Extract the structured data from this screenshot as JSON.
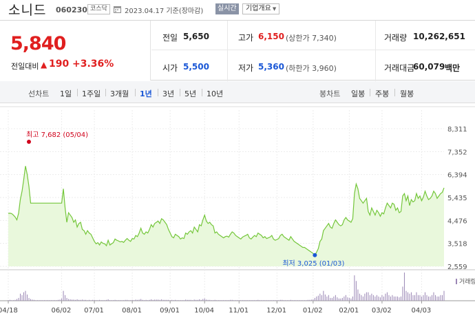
{
  "header": {
    "stock_name": "소니드",
    "stock_code": "060230",
    "market": "코스닥",
    "date_text": "2023.04.17  기준(장마감)",
    "realtime_label": "실시간",
    "overview_label": "기업개요",
    "calendar_icon": "calendar-icon"
  },
  "summary": {
    "current_price": "5,840",
    "diff_label": "전일대비",
    "diff_arrow": "▲",
    "diff_value": "190",
    "diff_rate": "+3.36%",
    "prev_close_label": "전일",
    "prev_close": "5,650",
    "high_label": "고가",
    "high": "6,150",
    "upper_limit": "(상한가 7,340)",
    "volume_label": "거래량",
    "volume": "10,262,651",
    "open_label": "시가",
    "open": "5,500",
    "low_label": "저가",
    "low": "5,360",
    "lower_limit": "(하한가 3,960)",
    "amount_label": "거래대금",
    "amount": "60,079",
    "amount_unit": "백만",
    "colors": {
      "up": "#e01f1f",
      "down": "#1a57d6"
    }
  },
  "period_bar": {
    "line_chart_label": "선차트",
    "line_periods": [
      "1일",
      "1주일",
      "3개월",
      "1년",
      "3년",
      "5년",
      "10년"
    ],
    "active_period": "1년",
    "candle_chart_label": "봉차트",
    "candle_periods": [
      "일봉",
      "주봉",
      "월봉"
    ]
  },
  "chart_data": {
    "type": "area",
    "series_color": "#73c639",
    "fill_color": "#e9f8dc",
    "y_ticks": [
      "8,311",
      "7,352",
      "6,394",
      "5,435",
      "4,476",
      "3,518",
      "2,559"
    ],
    "ylim": [
      2559,
      8311
    ],
    "x_ticks": [
      "04/18",
      "06/02",
      "07/01",
      "08/01",
      "09/01",
      "10/04",
      "11/01",
      "12/01",
      "01/02",
      "02/01",
      "03/02",
      "04/03"
    ],
    "x_tick_index": [
      0,
      31,
      50,
      72,
      94,
      114,
      134,
      156,
      177,
      198,
      217,
      240
    ],
    "high_annotation": "최고 7,682 (05/04)",
    "low_annotation": "최저 3,025 (01/03)",
    "high_index": 11,
    "low_index": 178,
    "high_value": 7682,
    "low_value": 3025,
    "volume_label": "거래량",
    "values": [
      4770,
      4780,
      4760,
      4700,
      4620,
      4500,
      4780,
      5350,
      5700,
      6200,
      6750,
      6400,
      5900,
      5200,
      5200,
      5200,
      5200,
      5200,
      5200,
      5200,
      5200,
      5200,
      5200,
      5200,
      5200,
      5200,
      5200,
      5200,
      5200,
      5200,
      5200,
      5200,
      5800,
      5000,
      4400,
      4800,
      4700,
      4600,
      4400,
      4500,
      4200,
      4350,
      4400,
      4100,
      4050,
      3900,
      4050,
      3950,
      3900,
      3750,
      3600,
      3500,
      3550,
      3450,
      3580,
      3520,
      3500,
      3420,
      3650,
      3450,
      3500,
      3550,
      3700,
      3650,
      3620,
      3580,
      3600,
      3560,
      3650,
      3720,
      3650,
      3600,
      3720,
      3700,
      3850,
      3800,
      3950,
      4150,
      3950,
      3900,
      4000,
      3950,
      4100,
      4300,
      4200,
      4350,
      4400,
      4450,
      4350,
      4550,
      4500,
      4400,
      4300,
      4100,
      3950,
      3800,
      3750,
      3900,
      3850,
      3800,
      3700,
      3750,
      3720,
      3950,
      3900,
      4000,
      4050,
      3950,
      4200,
      4100,
      4000,
      4300,
      4250,
      4500,
      4700,
      4450,
      4350,
      4400,
      4300,
      4250,
      3950,
      4000,
      3900,
      3850,
      3800,
      3750,
      3800,
      3820,
      3780,
      3900,
      4000,
      3950,
      3850,
      3800,
      3750,
      3700,
      3780,
      3820,
      3850,
      3900,
      3750,
      3700,
      3780,
      3850,
      3800,
      3950,
      3900,
      3850,
      3750,
      3800,
      3720,
      3750,
      3780,
      3850,
      3700,
      3650,
      3680,
      3720,
      3850,
      3900,
      3800,
      3750,
      3700,
      3650,
      3800,
      3700,
      3600,
      3550,
      3500,
      3450,
      3400,
      3350,
      3350,
      3300,
      3250,
      3200,
      3150,
      3100,
      3025,
      3150,
      3300,
      3600,
      3700,
      4050,
      4150,
      4250,
      4350,
      4200,
      4150,
      4350,
      4500,
      4400,
      4300,
      4250,
      4300,
      4500,
      4600,
      4500,
      4450,
      4400,
      4550,
      5600,
      6000,
      5800,
      5400,
      5300,
      5200,
      5300,
      5400,
      4850,
      4700,
      5000,
      4850,
      4700,
      4900,
      4800,
      4650,
      4800,
      4750,
      5000,
      5200,
      5100,
      5000,
      5200,
      5150,
      4900,
      5000,
      4800,
      4850,
      5500,
      5600,
      5300,
      5500,
      5100,
      5350,
      5250,
      5300,
      5600,
      5400,
      5500,
      5300,
      5450,
      5700,
      5500,
      5350,
      5400,
      5500,
      5700,
      5600,
      5400,
      5500,
      5600,
      5650,
      5840
    ],
    "volumes": [
      0.02,
      0.03,
      0.02,
      0.02,
      0.03,
      0.06,
      0.1,
      0.25,
      0.2,
      0.3,
      0.35,
      0.22,
      0.1,
      0.06,
      0.04,
      0.03,
      0.02,
      0.02,
      0.02,
      0.02,
      0.02,
      0.02,
      0.02,
      0.02,
      0.02,
      0.02,
      0.02,
      0.02,
      0.02,
      0.03,
      0.04,
      0.08,
      0.35,
      0.2,
      0.1,
      0.06,
      0.05,
      0.04,
      0.04,
      0.03,
      0.05,
      0.03,
      0.03,
      0.04,
      0.03,
      0.03,
      0.02,
      0.03,
      0.02,
      0.03,
      0.03,
      0.02,
      0.02,
      0.03,
      0.02,
      0.02,
      0.02,
      0.03,
      0.05,
      0.02,
      0.02,
      0.02,
      0.03,
      0.02,
      0.02,
      0.02,
      0.02,
      0.02,
      0.03,
      0.03,
      0.02,
      0.02,
      0.03,
      0.02,
      0.04,
      0.03,
      0.04,
      0.06,
      0.03,
      0.02,
      0.03,
      0.02,
      0.03,
      0.05,
      0.03,
      0.04,
      0.04,
      0.04,
      0.03,
      0.05,
      0.03,
      0.03,
      0.03,
      0.03,
      0.02,
      0.03,
      0.02,
      0.03,
      0.02,
      0.02,
      0.02,
      0.02,
      0.02,
      0.04,
      0.03,
      0.03,
      0.03,
      0.02,
      0.04,
      0.03,
      0.03,
      0.05,
      0.03,
      0.06,
      0.08,
      0.04,
      0.03,
      0.03,
      0.02,
      0.02,
      0.03,
      0.02,
      0.02,
      0.02,
      0.02,
      0.02,
      0.02,
      0.02,
      0.02,
      0.03,
      0.03,
      0.02,
      0.02,
      0.02,
      0.02,
      0.02,
      0.02,
      0.02,
      0.02,
      0.02,
      0.02,
      0.02,
      0.02,
      0.02,
      0.02,
      0.03,
      0.02,
      0.02,
      0.02,
      0.02,
      0.02,
      0.02,
      0.02,
      0.02,
      0.02,
      0.02,
      0.02,
      0.02,
      0.03,
      0.03,
      0.02,
      0.02,
      0.02,
      0.02,
      0.03,
      0.02,
      0.02,
      0.02,
      0.02,
      0.02,
      0.02,
      0.02,
      0.02,
      0.02,
      0.03,
      0.03,
      0.04,
      0.05,
      0.1,
      0.15,
      0.18,
      0.25,
      0.2,
      0.35,
      0.22,
      0.15,
      0.2,
      0.1,
      0.1,
      0.15,
      0.2,
      0.12,
      0.08,
      0.08,
      0.1,
      0.15,
      0.2,
      0.12,
      0.1,
      0.08,
      0.15,
      0.9,
      0.7,
      0.4,
      0.25,
      0.2,
      0.15,
      0.25,
      0.3,
      0.3,
      0.2,
      0.25,
      0.2,
      0.15,
      0.2,
      0.15,
      0.12,
      0.2,
      0.15,
      0.25,
      0.3,
      0.2,
      0.15,
      0.2,
      0.15,
      0.15,
      0.15,
      0.12,
      0.15,
      0.5,
      1.0,
      0.35,
      0.3,
      0.25,
      0.3,
      0.2,
      0.2,
      0.3,
      0.2,
      0.2,
      0.15,
      0.2,
      0.3,
      0.2,
      0.15,
      0.15,
      0.2,
      0.3,
      0.2,
      0.15,
      0.15,
      0.2,
      0.2,
      0.35
    ]
  }
}
